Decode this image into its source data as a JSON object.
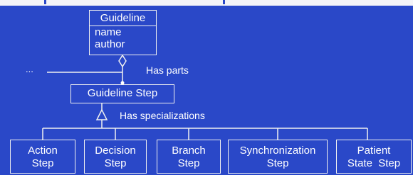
{
  "guideline_class": {
    "name": "Guideline",
    "attributes": [
      "name",
      "author"
    ]
  },
  "step_class": {
    "name": "Guideline Step"
  },
  "ellipsis": "...",
  "relations": {
    "parts": "Has parts",
    "specializations": "Has specializations"
  },
  "subclasses": [
    {
      "line1": "Action",
      "line2": "Step"
    },
    {
      "line1": "Decision",
      "line2": "Step"
    },
    {
      "line1": "Branch",
      "line2": "Step"
    },
    {
      "line1": "Synchronization",
      "line2": "Step"
    },
    {
      "line1": "Patient",
      "line2": "State  Step"
    }
  ],
  "colors": {
    "background": "#2a48c8",
    "lines": "#f0f0f0",
    "text": "#ffffff"
  }
}
